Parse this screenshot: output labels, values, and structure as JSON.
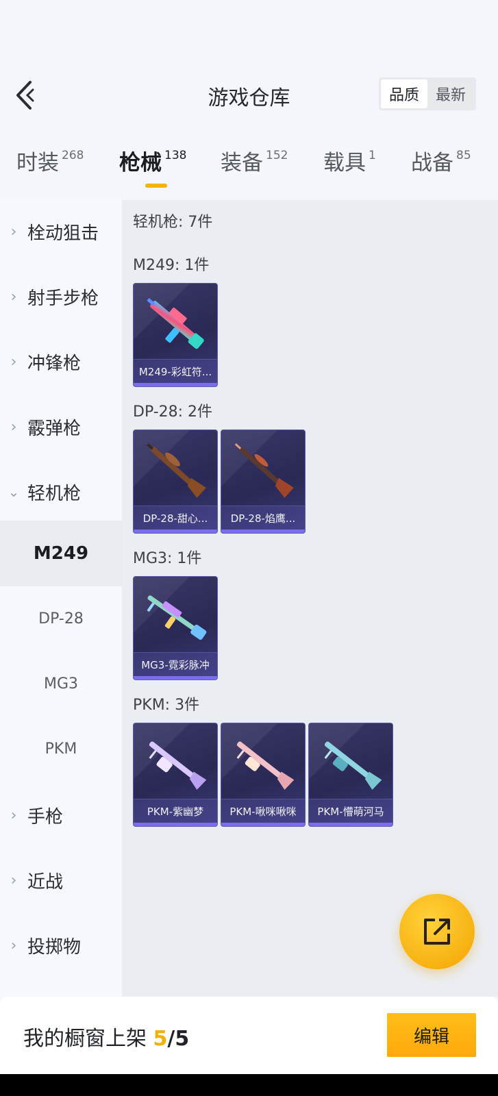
{
  "header": {
    "title": "游戏仓库",
    "sort": [
      "品质",
      "最新"
    ],
    "sort_active": "品质"
  },
  "tabs": [
    {
      "label": "时装",
      "count": "268"
    },
    {
      "label": "枪械",
      "count": "138"
    },
    {
      "label": "装备",
      "count": "152"
    },
    {
      "label": "载具",
      "count": "1"
    },
    {
      "label": "战备",
      "count": "85"
    }
  ],
  "sidebar": {
    "items": [
      {
        "label": "栓动狙击"
      },
      {
        "label": "射手步枪"
      },
      {
        "label": "冲锋枪"
      },
      {
        "label": "霰弹枪"
      },
      {
        "label": "轻机枪"
      },
      {
        "label": "手枪"
      },
      {
        "label": "近战"
      },
      {
        "label": "投掷物"
      }
    ],
    "sub_items": [
      "M249",
      "DP-28",
      "MG3",
      "PKM"
    ]
  },
  "content": {
    "category_title": "轻机枪: 7件",
    "groups": [
      {
        "title": "M249: 1件",
        "items": [
          "M249-彩虹符..."
        ]
      },
      {
        "title": "DP-28: 2件",
        "items": [
          "DP-28-甜心...",
          "DP-28-焰鹰..."
        ]
      },
      {
        "title": "MG3: 1件",
        "items": [
          "MG3-霓彩脉冲"
        ]
      },
      {
        "title": "PKM: 3件",
        "items": [
          "PKM-紫幽梦",
          "PKM-啾咪啾咪",
          "PKM-懵萌河马"
        ]
      }
    ]
  },
  "bottom": {
    "label": "我的橱窗上架",
    "current": "5",
    "separator": "/",
    "max": "5",
    "edit": "编辑"
  },
  "colors": {
    "accent": "#f5b400",
    "card_bg": "#2d2b5a",
    "card_bar": "#7b6cf0"
  }
}
